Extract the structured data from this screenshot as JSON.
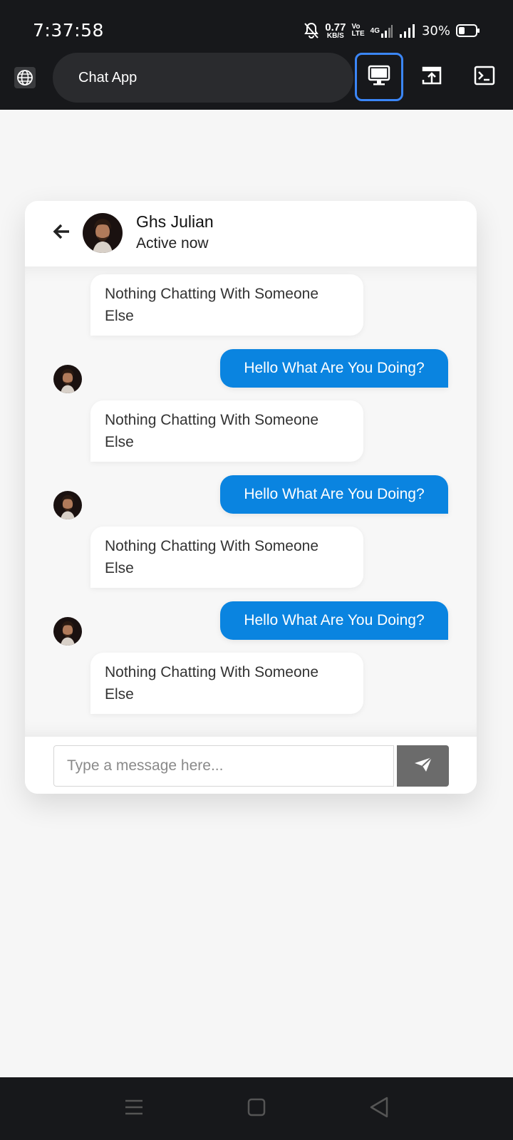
{
  "status_bar": {
    "time": "7:37:58",
    "net_speed_value": "0.77",
    "net_speed_unit": "KB/S",
    "volte_top": "Vo",
    "volte_bottom": "LTE",
    "network_type": "4G",
    "battery_percent": "30%"
  },
  "toolbar": {
    "url_title": "Chat App",
    "accent_color": "#3b86f7"
  },
  "chat": {
    "contact_name": "Ghs Julian",
    "contact_status": "Active now",
    "messages": [
      {
        "direction": "incoming",
        "text": "Nothing Chatting With Someone Else"
      },
      {
        "direction": "outgoing",
        "text": "Hello What Are You Doing?"
      },
      {
        "direction": "incoming",
        "text": "Nothing Chatting With Someone Else"
      },
      {
        "direction": "outgoing",
        "text": "Hello What Are You Doing?"
      },
      {
        "direction": "incoming",
        "text": "Nothing Chatting With Someone Else"
      },
      {
        "direction": "outgoing",
        "text": "Hello What Are You Doing?"
      },
      {
        "direction": "incoming",
        "text": "Nothing Chatting With Someone Else"
      }
    ],
    "input_placeholder": "Type a message here...",
    "outgoing_color": "#0a84e0"
  },
  "icons": {
    "back": "arrow-left-icon",
    "send": "paper-plane-icon",
    "globe": "globe-icon",
    "desktop": "desktop-icon",
    "share": "share-icon",
    "terminal": "terminal-icon"
  }
}
